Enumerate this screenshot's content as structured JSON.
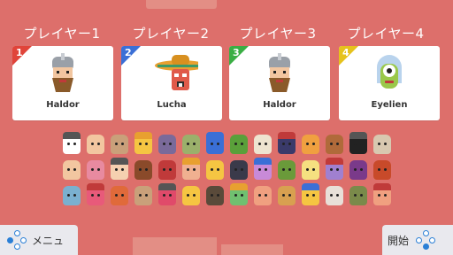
{
  "players": [
    {
      "label": "プレイヤー1",
      "number": "1",
      "badge_color": "#e0443a",
      "name": "Haldor",
      "avatar": "helmet-viking"
    },
    {
      "label": "プレイヤー2",
      "number": "2",
      "badge_color": "#3a6fd6",
      "name": "Lucha",
      "avatar": "sombrero-wrestler"
    },
    {
      "label": "プレイヤー3",
      "number": "3",
      "badge_color": "#3aae44",
      "name": "Haldor",
      "avatar": "helmet-viking"
    },
    {
      "label": "プレイヤー4",
      "number": "4",
      "badge_color": "#e6c21c",
      "name": "Eyelien",
      "avatar": "one-eyed-alien"
    }
  ],
  "roster_colors": [
    [
      "#ffffff",
      "#f2c6a0",
      "#c9a07a",
      "#f5c542",
      "#7a6a9a",
      "#9bb06b",
      "#3a6fd6",
      "#5aa03a",
      "#eee4d0",
      "#3a3a6a",
      "#f0a040",
      "#b06a3a",
      "#222222",
      "#d8c8b0"
    ],
    [
      "#f2c6a0",
      "#e88aa0",
      "#f5d0b0",
      "#8a4a2a",
      "#c03a3a",
      "#f0b090",
      "#f5c542",
      "#3a3a4a",
      "#c88ad8",
      "#6a9a3a",
      "#f5e080",
      "#a080d0",
      "#7a3a8a",
      "#c84a2a"
    ],
    [
      "#7ab0d0",
      "#e85a7a",
      "#e06a3a",
      "#c9a07a",
      "#e04a6a",
      "#f5c542",
      "#5a4a3a",
      "#70c070",
      "#f0a080",
      "#d8a050",
      "#f5c542",
      "#e8e0d8",
      "#7a8a4a",
      "#f0a080"
    ]
  ],
  "footer": {
    "menu_label": "メニュ",
    "start_label": "開始"
  }
}
